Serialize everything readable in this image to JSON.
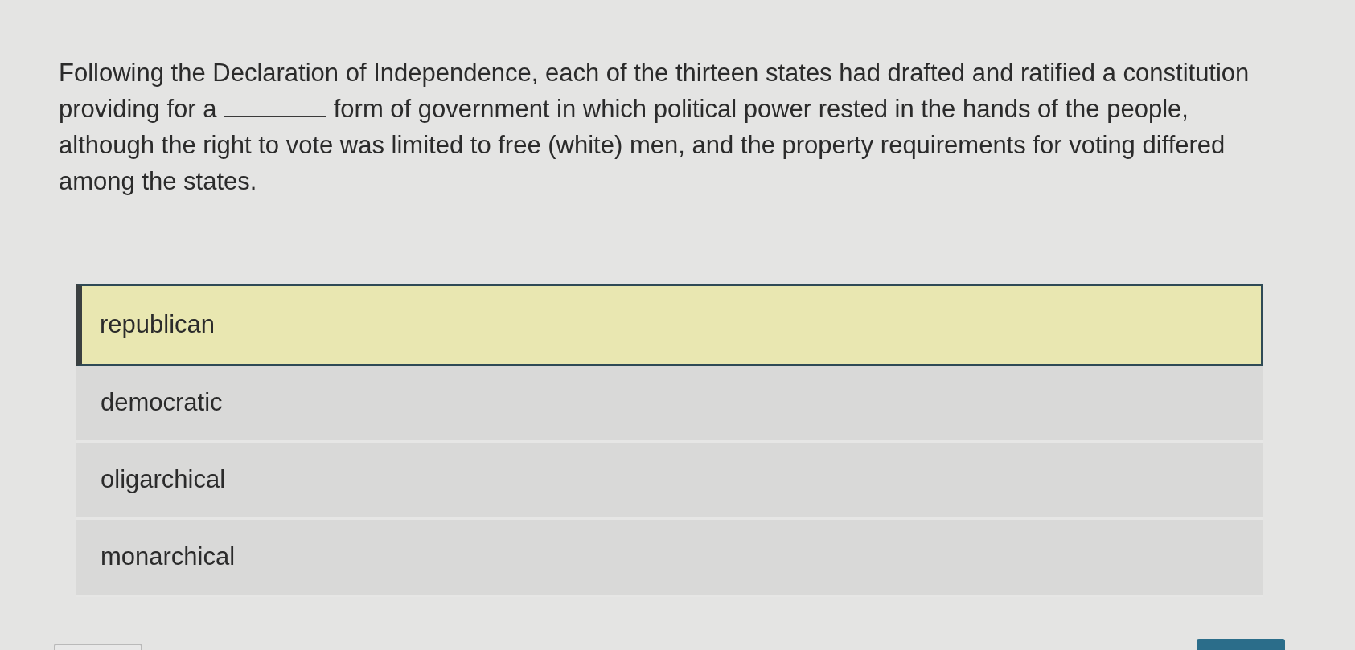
{
  "question": {
    "parts": [
      {
        "kind": "text",
        "text": "Following the Declaration of Independence, each of the thirteen states had drafted and ratified a constitution providing for a"
      },
      {
        "kind": "blank"
      },
      {
        "kind": "text",
        "text": "form of government in which political power rested in the hands of the people, although the right to vote was limited to free (white) men, and the property requirements for voting differed among the states."
      }
    ]
  },
  "options": [
    {
      "label": "republican",
      "selected": true
    },
    {
      "label": "democratic",
      "selected": false
    },
    {
      "label": "oligarchical",
      "selected": false
    },
    {
      "label": "monarchical",
      "selected": false
    }
  ]
}
